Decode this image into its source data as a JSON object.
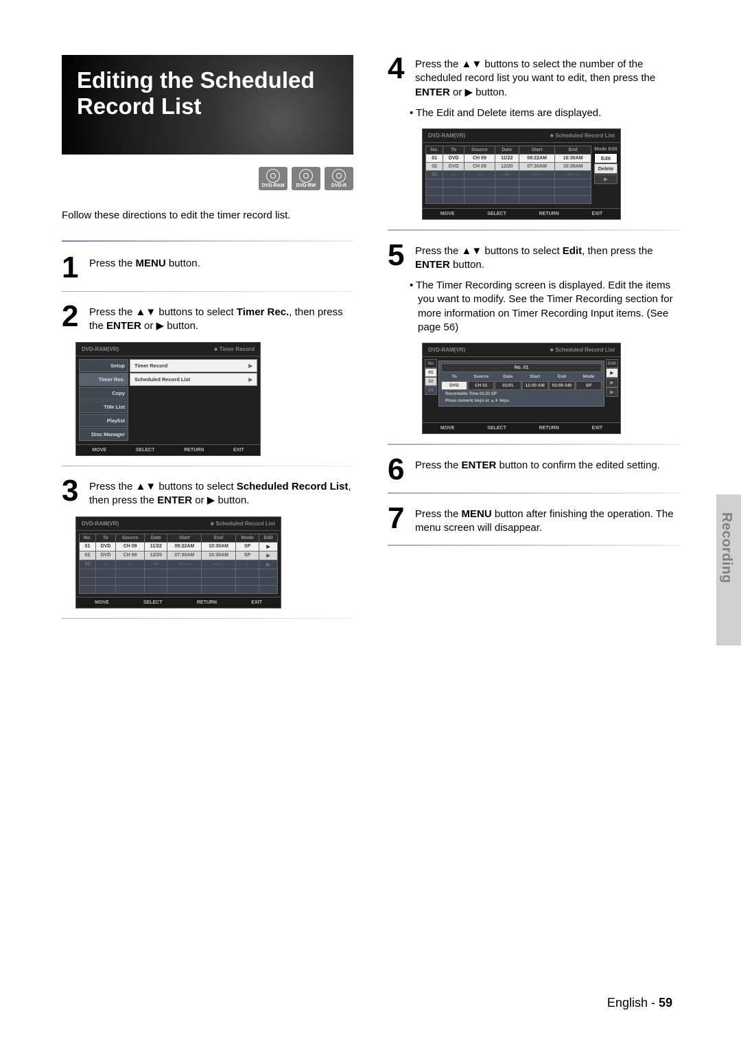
{
  "title": "Editing the Scheduled Record List",
  "disc_types": [
    "DVD-RAM",
    "DVD-RW",
    "DVD-R"
  ],
  "intro": "Follow these directions to edit the timer record list.",
  "steps": {
    "s1": {
      "num": "1",
      "text_a": "Press the ",
      "bold_a": "MENU",
      "text_b": " button."
    },
    "s2": {
      "num": "2",
      "text_a": "Press the ▲▼ buttons to select ",
      "bold_a": "Timer Rec.",
      "text_b": ", then press the ",
      "bold_b": "ENTER",
      "text_c": " or ▶ button."
    },
    "s3": {
      "num": "3",
      "text_a": "Press the ▲▼ buttons to select ",
      "bold_a": "Scheduled Record List",
      "text_b": ", then press the ",
      "bold_b": "ENTER",
      "text_c": " or ▶ button."
    },
    "s4": {
      "num": "4",
      "text_a": "Press the ▲▼ buttons to select the number of the scheduled record list you want to edit, then press the ",
      "bold_a": "ENTER",
      "text_b": " or ▶ button.",
      "bullet": "The Edit and Delete items are displayed."
    },
    "s5": {
      "num": "5",
      "text_a": "Press the ▲▼ buttons to select ",
      "bold_a": "Edit",
      "text_b": ", then press the ",
      "bold_b": "ENTER",
      "text_c": " button.",
      "bullet": "The Timer Recording screen is displayed. Edit the items you want to modify. See the Timer Recording section for more information on Timer Recording Input items. (See page 56)"
    },
    "s6": {
      "num": "6",
      "text_a": "Press the ",
      "bold_a": "ENTER",
      "text_b": " button to confirm the edited setting."
    },
    "s7": {
      "num": "7",
      "text_a": "Press the ",
      "bold_a": "MENU",
      "text_b": " button after finishing the operation. The menu screen will disappear."
    }
  },
  "osd_common": {
    "disc_label": "DVD-RAM(VR)",
    "footer": {
      "move": "MOVE",
      "select": "SELECT",
      "return": "RETURN",
      "exit": "EXIT"
    }
  },
  "osd2": {
    "title": "Timer Record",
    "left": [
      "Setup",
      "Timer Rec.",
      "Copy",
      "Title List",
      "Playlist",
      "Disc Manager"
    ],
    "right": [
      {
        "label": "Timer Record",
        "arrow": "▶"
      },
      {
        "label": "Scheduled Record List",
        "arrow": "▶"
      }
    ]
  },
  "osd3": {
    "title": "Scheduled Record List",
    "headers": [
      "No.",
      "To",
      "Source",
      "Date",
      "Start",
      "End",
      "Mode",
      "Edit"
    ],
    "rows": [
      {
        "no": "01",
        "to": "DVD",
        "src": "CH  09",
        "date": "11/22",
        "start": "09:22AM",
        "end": "10:30AM",
        "mode": "SP",
        "edit": "▶"
      },
      {
        "no": "02",
        "to": "DVD",
        "src": "CH  09",
        "date": "12/20",
        "start": "07:30AM",
        "end": "10:30AM",
        "mode": "SP",
        "edit": "▶"
      },
      {
        "no": "03",
        "to": "--",
        "src": "---",
        "date": "--/--",
        "start": "--:-- --",
        "end": "--:-- --",
        "mode": "--",
        "edit": "▶"
      }
    ]
  },
  "osd4": {
    "title": "Scheduled Record List",
    "headers": [
      "No.",
      "To",
      "Source",
      "Date",
      "Start",
      "End",
      "Mode",
      "Edit"
    ],
    "rows": [
      {
        "no": "01",
        "to": "DVD",
        "src": "CH  09",
        "date": "11/22",
        "start": "09:22AM",
        "end": "10:30AM"
      },
      {
        "no": "02",
        "to": "DVD",
        "src": "CH  09",
        "date": "12/20",
        "start": "07:30AM",
        "end": "10:30AM"
      },
      {
        "no": "03",
        "to": "--",
        "src": "---",
        "date": "--/--",
        "start": "--:-- --",
        "end": "--:-- --"
      }
    ],
    "popup": [
      "Edit",
      "Delete"
    ]
  },
  "osd5": {
    "title": "Scheduled Record List",
    "side_head": [
      "No",
      "01",
      "02",
      "03"
    ],
    "side_right": "Edit",
    "panel_title": "No. 01",
    "panel_heads": [
      "To",
      "Source",
      "Date",
      "Start",
      "End",
      "Mode"
    ],
    "panel_vals": [
      "DVD",
      "CH 01",
      "01/01",
      "12:00 AM",
      "02:00 AM",
      "SP"
    ],
    "note1": "Recordable Time 01:23 SP",
    "note2": "Press numeric keys or ▲▼ keys."
  },
  "side_tab": "Recording",
  "footer": {
    "lang": "English - ",
    "page": "59"
  }
}
